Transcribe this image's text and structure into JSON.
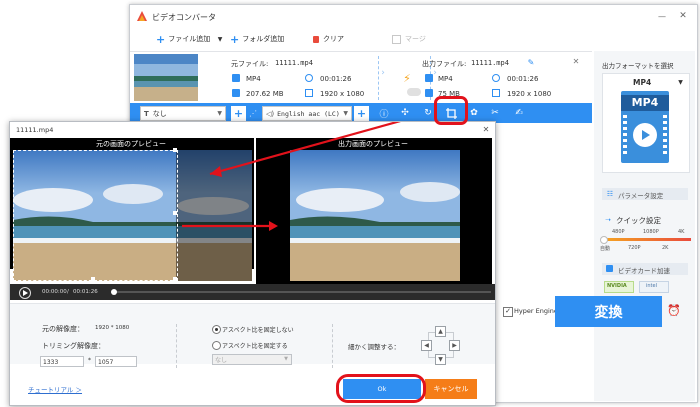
{
  "main_window": {
    "title": "ビデオコンバータ",
    "toolbar": {
      "add_file": "ファイル追加",
      "add_folder": "フォルダ追加",
      "clear": "クリア",
      "merge": "マージ"
    },
    "source": {
      "label": "元ファイル:",
      "filename": "11111.mp4",
      "format": "MP4",
      "duration": "00:01:26",
      "size": "207.62 MB",
      "resolution": "1920 x 1080"
    },
    "output": {
      "label": "出力ファイル:",
      "filename": "11111.mp4",
      "format": "MP4",
      "duration": "00:01:26",
      "size": "75 MB",
      "resolution": "1920 x 1080"
    },
    "subtitle_select": "なし",
    "audio_select": "English aac (LC)"
  },
  "right_panel": {
    "format_title": "出力フォーマットを選択",
    "format_name": "MP4",
    "format_icon_text": "MP4",
    "param_button": "パラメータ設定",
    "quality_title": "クイック設定",
    "quality_top": [
      "480P",
      "1080P",
      "4K"
    ],
    "quality_bottom": [
      "自動",
      "720P",
      "2K"
    ],
    "gpu_button": "ビデオカード加速",
    "gpu_brands": [
      "NVIDIA",
      "intel"
    ],
    "hyper_engine": "Hyper Engine",
    "convert": "変換"
  },
  "dialog": {
    "title": "11111.mp4",
    "preview_left_title": "元の画面のプレビュー",
    "preview_right_title": "出力画面のプレビュー",
    "time_current": "00:00:00",
    "time_sep": "/",
    "time_total": "00:01:26",
    "original_res_label": "元の解像度：",
    "original_res_value": "1920 * 1080",
    "crop_res_label": "トリミング解像度：",
    "crop_w": "1333",
    "crop_x": "*",
    "crop_h": "1057",
    "aspect_free": "アスペクト比を固定しない",
    "aspect_fixed": "アスペクト比を固定する",
    "aspect_select": "なし",
    "fine_adjust": "細かく調整する：",
    "tutorial": "チュートリアル ＞",
    "ok": "Ok",
    "cancel": "キャンセル"
  },
  "colors": {
    "accent_blue": "#2f8ff2",
    "orange": "#f57d18",
    "highlight_red": "#e2121b"
  }
}
